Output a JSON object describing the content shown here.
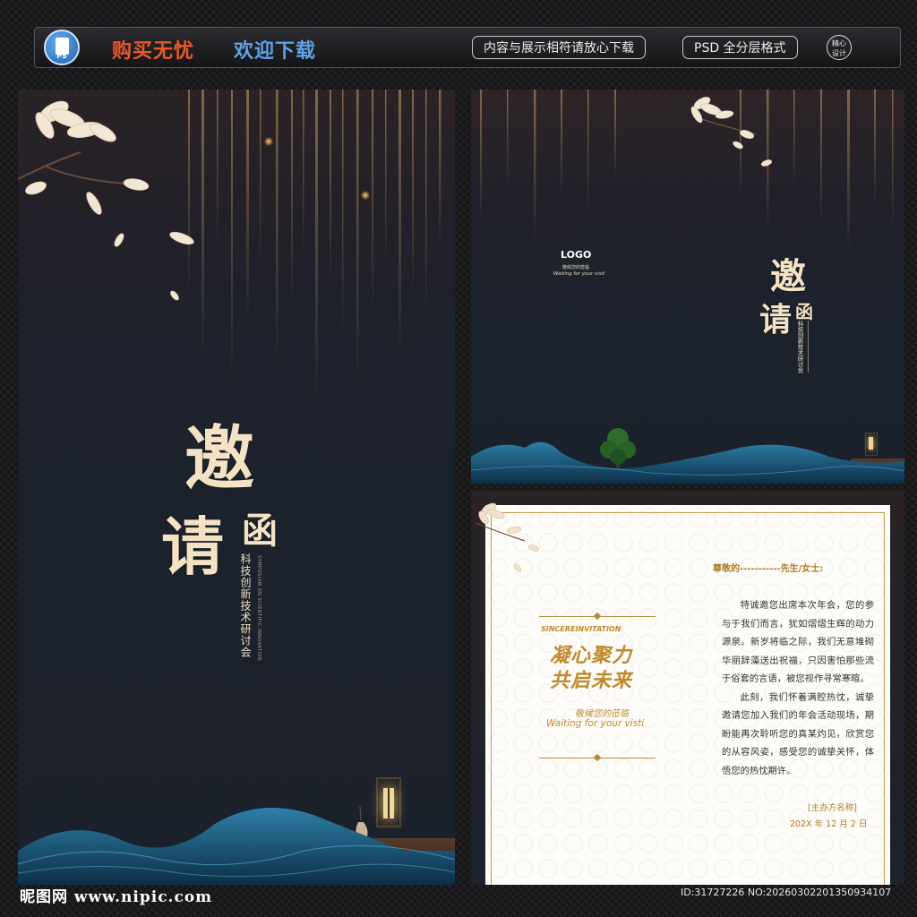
{
  "banner": {
    "icon_label": "PS",
    "slogan_buy": "购买无忧",
    "slogan_download": "欢迎下载",
    "tag_content": "内容与展示相符请放心下载",
    "tag_format": "PSD 全分层格式",
    "badge_line1": "精心",
    "badge_line2": "设计"
  },
  "poster": {
    "title_big1": "邀",
    "title_big2": "请",
    "title_small": "函",
    "subtitle_vertical": "科技创新技术研讨会",
    "subtitle_en": "SYMPOSIUM ON SCIENTIFIC INNOVATION"
  },
  "cover": {
    "logo": "LOGO",
    "logo_cn": "敬候您的莅临",
    "logo_en": "Waiting for your visit",
    "title_big1": "邀",
    "title_big2": "请",
    "title_small": "函",
    "subtitle_vertical": "科技创新技术研讨会"
  },
  "card": {
    "label_en": "SINCEREINVITATION",
    "slogan_line1": "凝心聚力",
    "slogan_line2": "共启未来",
    "wait_cn": "敬候您的莅临",
    "wait_en": "Waiting for your visti",
    "greeting": "尊敬的-----------先生/女士:",
    "para1": "特诚邀您出席本次年会，您的参与于我们而言，犹如熠熠生辉的动力源泉。新岁将临之际，我们无意堆砌华丽辞藻送出祝福，只因害怕那些流于俗套的言语，被您视作寻常寒暄。",
    "para2": "此刻，我们怀着满腔热忱，诚挚邀请您加入我们的年会活动现场，期盼能再次聆听您的真某灼见，欣赏您的从容风姿，感受您的诚挚关怀，体悟您的热忱期许。",
    "host": "[主办方名称]",
    "date": "202X 年 12 月 2 日"
  },
  "footer": {
    "site_logo": "昵图网 www.nipic.com",
    "id_text": "ID:31727226 NO:20260302201350934107"
  }
}
